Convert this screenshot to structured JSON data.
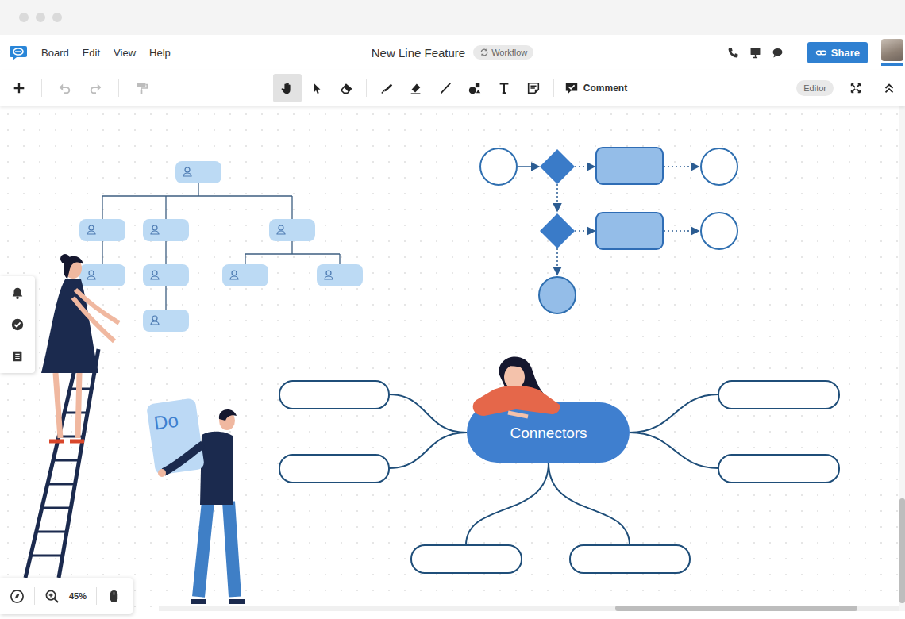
{
  "menu": [
    "Board",
    "Edit",
    "View",
    "Help"
  ],
  "document": {
    "title": "New Line Feature",
    "badge": "Workflow"
  },
  "share": {
    "label": "Share"
  },
  "toolbar": {
    "left": [
      {
        "kind": "add",
        "disabled": false
      },
      {
        "kind": "undo",
        "disabled": true
      },
      {
        "kind": "redo",
        "disabled": true
      },
      {
        "kind": "format",
        "disabled": true
      }
    ],
    "tools": [
      {
        "kind": "hand",
        "selected": true
      },
      {
        "kind": "pointer",
        "selected": false
      },
      {
        "kind": "eraser",
        "selected": false
      },
      {
        "kind": "pen",
        "selected": false
      },
      {
        "kind": "fill",
        "selected": false
      },
      {
        "kind": "line",
        "selected": false
      },
      {
        "kind": "shapes",
        "selected": false
      },
      {
        "kind": "text",
        "selected": false
      },
      {
        "kind": "note",
        "selected": false
      }
    ],
    "comment": {
      "label": "Comment"
    },
    "mode": {
      "label": "Editor"
    }
  },
  "canvas": {
    "mindmap": {
      "center": "Connectors"
    },
    "illustration": {
      "card_text": "Do"
    }
  },
  "zoom": {
    "level": "45%"
  }
}
